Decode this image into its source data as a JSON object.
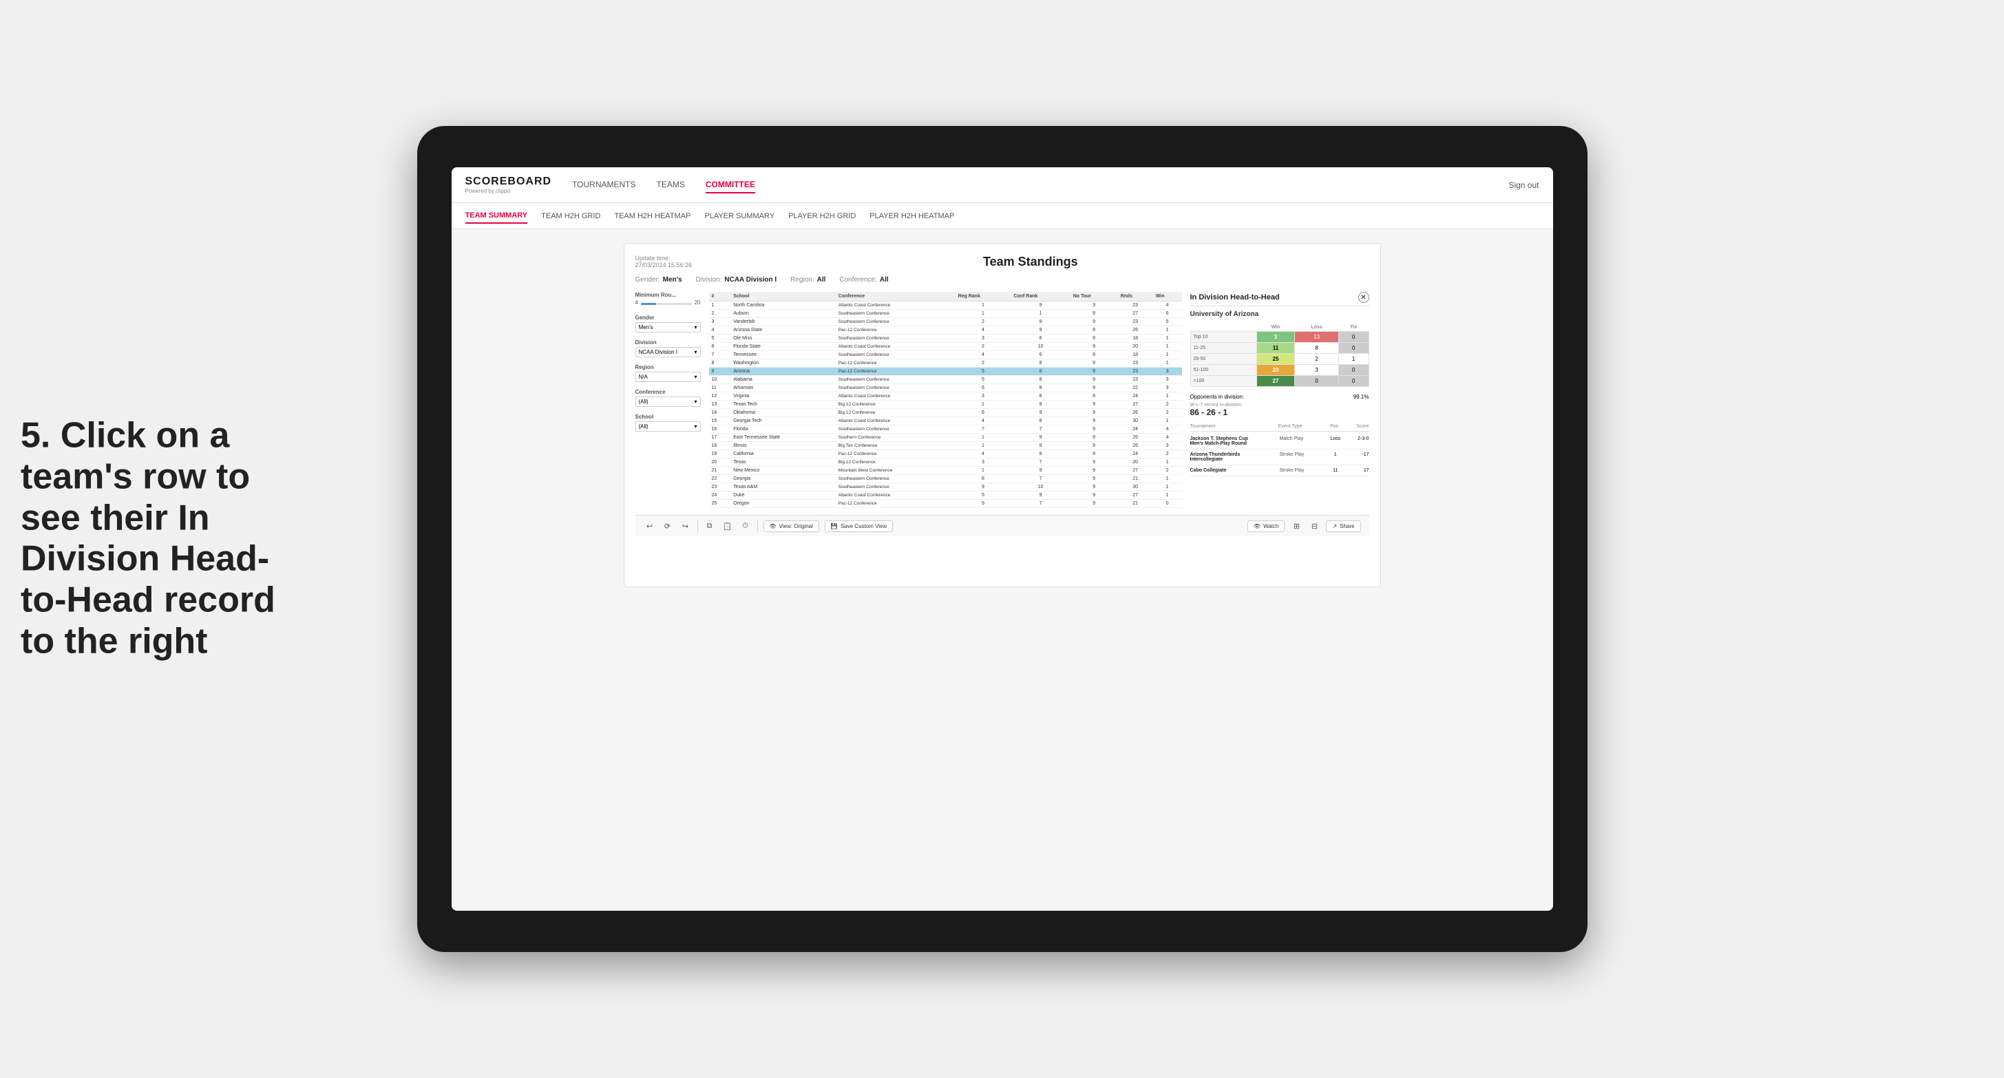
{
  "annotation": {
    "text": "5. Click on a team's row to see their In Division Head-to-Head record to the right"
  },
  "nav": {
    "logo": "SCOREBOARD",
    "logo_powered": "Powered by clippd",
    "items": [
      "TOURNAMENTS",
      "TEAMS",
      "COMMITTEE"
    ],
    "sign_out": "Sign out",
    "active_item": "COMMITTEE"
  },
  "sub_nav": {
    "items": [
      "TEAM SUMMARY",
      "TEAM H2H GRID",
      "TEAM H2H HEATMAP",
      "PLAYER SUMMARY",
      "PLAYER H2H GRID",
      "PLAYER H2H HEATMAP"
    ],
    "active_item": "PLAYER SUMMARY"
  },
  "dashboard": {
    "update_time_label": "Update time:",
    "update_time": "27/03/2024 15:56:26",
    "title": "Team Standings",
    "filters": {
      "gender_label": "Gender:",
      "gender_value": "Men's",
      "division_label": "Division:",
      "division_value": "NCAA Division I",
      "region_label": "Region:",
      "region_value": "All",
      "conference_label": "Conference:",
      "conference_value": "All"
    },
    "left_panel": {
      "min_rou_label": "Minimum Rou...",
      "min_rou_val_left": "4",
      "min_rou_val_right": "20",
      "gender_label": "Gender",
      "gender_value": "Men's",
      "division_label": "Division",
      "division_value": "NCAA Division I",
      "region_label": "Region",
      "region_value": "N/A",
      "conference_label": "Conference",
      "conference_value": "(All)",
      "school_label": "School",
      "school_value": "(All)"
    },
    "table": {
      "headers": [
        "#",
        "School",
        "Conference",
        "Reg Rank",
        "Conf Rank",
        "No Tour",
        "Rnds",
        "Win"
      ],
      "rows": [
        {
          "rank": "1",
          "school": "North Carolina",
          "conference": "Atlantic Coast Conference",
          "reg_rank": "1",
          "conf_rank": "9",
          "no_tour": "3",
          "rnds": "23",
          "win": "4"
        },
        {
          "rank": "2",
          "school": "Auburn",
          "conference": "Southeastern Conference",
          "reg_rank": "1",
          "conf_rank": "1",
          "no_tour": "9",
          "rnds": "27",
          "win": "6"
        },
        {
          "rank": "3",
          "school": "Vanderbilt",
          "conference": "Southeastern Conference",
          "reg_rank": "2",
          "conf_rank": "8",
          "no_tour": "9",
          "rnds": "23",
          "win": "5"
        },
        {
          "rank": "4",
          "school": "Arizona State",
          "conference": "Pac-12 Conference",
          "reg_rank": "4",
          "conf_rank": "9",
          "no_tour": "8",
          "rnds": "26",
          "win": "1"
        },
        {
          "rank": "5",
          "school": "Ole Miss",
          "conference": "Southeastern Conference",
          "reg_rank": "3",
          "conf_rank": "6",
          "no_tour": "8",
          "rnds": "18",
          "win": "1"
        },
        {
          "rank": "6",
          "school": "Florida State",
          "conference": "Atlantic Coast Conference",
          "reg_rank": "2",
          "conf_rank": "10",
          "no_tour": "9",
          "rnds": "20",
          "win": "1"
        },
        {
          "rank": "7",
          "school": "Tennessee",
          "conference": "Southeastern Conference",
          "reg_rank": "4",
          "conf_rank": "6",
          "no_tour": "8",
          "rnds": "18",
          "win": "1"
        },
        {
          "rank": "8",
          "school": "Washington",
          "conference": "Pac-12 Conference",
          "reg_rank": "2",
          "conf_rank": "8",
          "no_tour": "9",
          "rnds": "23",
          "win": "1"
        },
        {
          "rank": "9",
          "school": "Arizona",
          "conference": "Pac-12 Conference",
          "reg_rank": "5",
          "conf_rank": "8",
          "no_tour": "9",
          "rnds": "23",
          "win": "3",
          "highlighted": true
        },
        {
          "rank": "10",
          "school": "Alabama",
          "conference": "Southeastern Conference",
          "reg_rank": "5",
          "conf_rank": "8",
          "no_tour": "9",
          "rnds": "23",
          "win": "3"
        },
        {
          "rank": "11",
          "school": "Arkansas",
          "conference": "Southeastern Conference",
          "reg_rank": "6",
          "conf_rank": "8",
          "no_tour": "9",
          "rnds": "22",
          "win": "3"
        },
        {
          "rank": "12",
          "school": "Virginia",
          "conference": "Atlantic Coast Conference",
          "reg_rank": "3",
          "conf_rank": "8",
          "no_tour": "8",
          "rnds": "24",
          "win": "1"
        },
        {
          "rank": "13",
          "school": "Texas Tech",
          "conference": "Big 12 Conference",
          "reg_rank": "1",
          "conf_rank": "9",
          "no_tour": "9",
          "rnds": "27",
          "win": "2"
        },
        {
          "rank": "14",
          "school": "Oklahoma",
          "conference": "Big 12 Conference",
          "reg_rank": "6",
          "conf_rank": "9",
          "no_tour": "9",
          "rnds": "26",
          "win": "2"
        },
        {
          "rank": "15",
          "school": "Georgia Tech",
          "conference": "Atlantic Coast Conference",
          "reg_rank": "4",
          "conf_rank": "8",
          "no_tour": "9",
          "rnds": "30",
          "win": "1"
        },
        {
          "rank": "16",
          "school": "Florida",
          "conference": "Southeastern Conference",
          "reg_rank": "7",
          "conf_rank": "7",
          "no_tour": "9",
          "rnds": "24",
          "win": "4"
        },
        {
          "rank": "17",
          "school": "East Tennessee State",
          "conference": "Southern Conference",
          "reg_rank": "1",
          "conf_rank": "9",
          "no_tour": "9",
          "rnds": "26",
          "win": "4"
        },
        {
          "rank": "18",
          "school": "Illinois",
          "conference": "Big Ten Conference",
          "reg_rank": "1",
          "conf_rank": "9",
          "no_tour": "9",
          "rnds": "26",
          "win": "3"
        },
        {
          "rank": "19",
          "school": "California",
          "conference": "Pac-12 Conference",
          "reg_rank": "4",
          "conf_rank": "8",
          "no_tour": "9",
          "rnds": "24",
          "win": "2"
        },
        {
          "rank": "20",
          "school": "Texas",
          "conference": "Big 12 Conference",
          "reg_rank": "3",
          "conf_rank": "7",
          "no_tour": "9",
          "rnds": "20",
          "win": "1"
        },
        {
          "rank": "21",
          "school": "New Mexico",
          "conference": "Mountain West Conference",
          "reg_rank": "1",
          "conf_rank": "9",
          "no_tour": "9",
          "rnds": "27",
          "win": "2"
        },
        {
          "rank": "22",
          "school": "Georgia",
          "conference": "Southeastern Conference",
          "reg_rank": "8",
          "conf_rank": "7",
          "no_tour": "9",
          "rnds": "21",
          "win": "1"
        },
        {
          "rank": "23",
          "school": "Texas A&M",
          "conference": "Southeastern Conference",
          "reg_rank": "9",
          "conf_rank": "10",
          "no_tour": "9",
          "rnds": "30",
          "win": "1"
        },
        {
          "rank": "24",
          "school": "Duke",
          "conference": "Atlantic Coast Conference",
          "reg_rank": "5",
          "conf_rank": "9",
          "no_tour": "9",
          "rnds": "27",
          "win": "1"
        },
        {
          "rank": "25",
          "school": "Oregon",
          "conference": "Pac-12 Conference",
          "reg_rank": "5",
          "conf_rank": "7",
          "no_tour": "9",
          "rnds": "21",
          "win": "0"
        }
      ]
    },
    "h2h": {
      "title": "In Division Head-to-Head",
      "team_name": "University of Arizona",
      "rows": [
        {
          "label": "Top 10",
          "win": "3",
          "loss": "13",
          "tie": "0",
          "win_class": "cell-green",
          "loss_class": "cell-red",
          "tie_class": "cell-gray"
        },
        {
          "label": "11-25",
          "win": "11",
          "loss": "8",
          "tie": "0",
          "win_class": "cell-lightgreen",
          "loss_class": "",
          "tie_class": "cell-gray"
        },
        {
          "label": "26-50",
          "win": "25",
          "loss": "2",
          "tie": "1",
          "win_class": "cell-lightyellow",
          "loss_class": "",
          "tie_class": ""
        },
        {
          "label": "51-100",
          "win": "20",
          "loss": "3",
          "tie": "0",
          "win_class": "cell-orange",
          "loss_class": "",
          "tie_class": "cell-gray"
        },
        {
          "label": ">100",
          "win": "27",
          "loss": "0",
          "tie": "0",
          "win_class": "cell-darkgreen",
          "loss_class": "cell-gray",
          "tie_class": "cell-gray"
        }
      ],
      "opponents_label": "Opponents in division:",
      "opponents_value": "99.1%",
      "wlt_label": "W-L-T record in-division:",
      "wlt_value": "86 - 26 - 1",
      "tournaments": [
        {
          "name": "Jackson T. Stephens Cup Men's Match-Play Round",
          "event_type": "Match Play",
          "pos": "Loss",
          "score": "2-3-0"
        },
        {
          "name": "Arizona Thunderbirds Intercollegiate",
          "event_type": "Stroke Play",
          "pos": "1",
          "score": "-17"
        },
        {
          "name": "Cabo Collegiate",
          "event_type": "Stroke Play",
          "pos": "11",
          "score": "17"
        }
      ]
    },
    "toolbar": {
      "view_original": "View: Original",
      "save_custom": "Save Custom View",
      "watch": "Watch",
      "share": "Share"
    }
  }
}
